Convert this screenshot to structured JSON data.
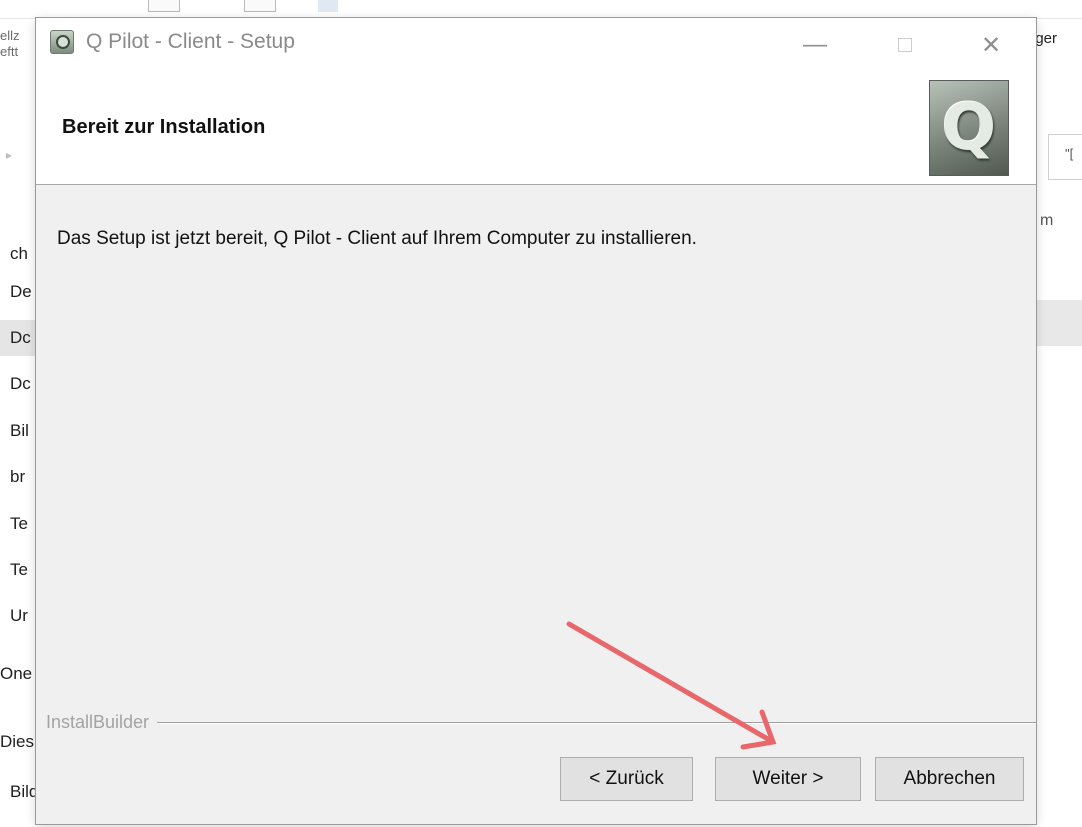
{
  "background": {
    "left_top_text": [
      "ellz",
      "eftt"
    ],
    "right_top_text": "iger",
    "search_text": "\"[",
    "right_column_text": "m",
    "nav_items": [
      {
        "label": "ch"
      },
      {
        "label": "De"
      },
      {
        "label": "Dc"
      },
      {
        "label": "Dc"
      },
      {
        "label": "Bil"
      },
      {
        "label": "br"
      },
      {
        "label": "Te"
      },
      {
        "label": "Te"
      },
      {
        "label": "Ur"
      },
      {
        "label": "One"
      },
      {
        "label": "Dies"
      },
      {
        "label": "Bilder"
      }
    ]
  },
  "dialog": {
    "title": "Q Pilot - Client - Setup",
    "controls": {
      "minimize": "—",
      "maximize": "",
      "close": "✕"
    },
    "header_title": "Bereit zur Installation",
    "logo_letter": "Q",
    "body_text": "Das Setup ist jetzt bereit, Q Pilot - Client auf Ihrem Computer zu installieren.",
    "brand": "InstallBuilder",
    "buttons": {
      "back": "< Zurück",
      "next": "Weiter >",
      "cancel": "Abbrechen"
    }
  },
  "annotation": {
    "arrow_color": "#e8676b"
  }
}
